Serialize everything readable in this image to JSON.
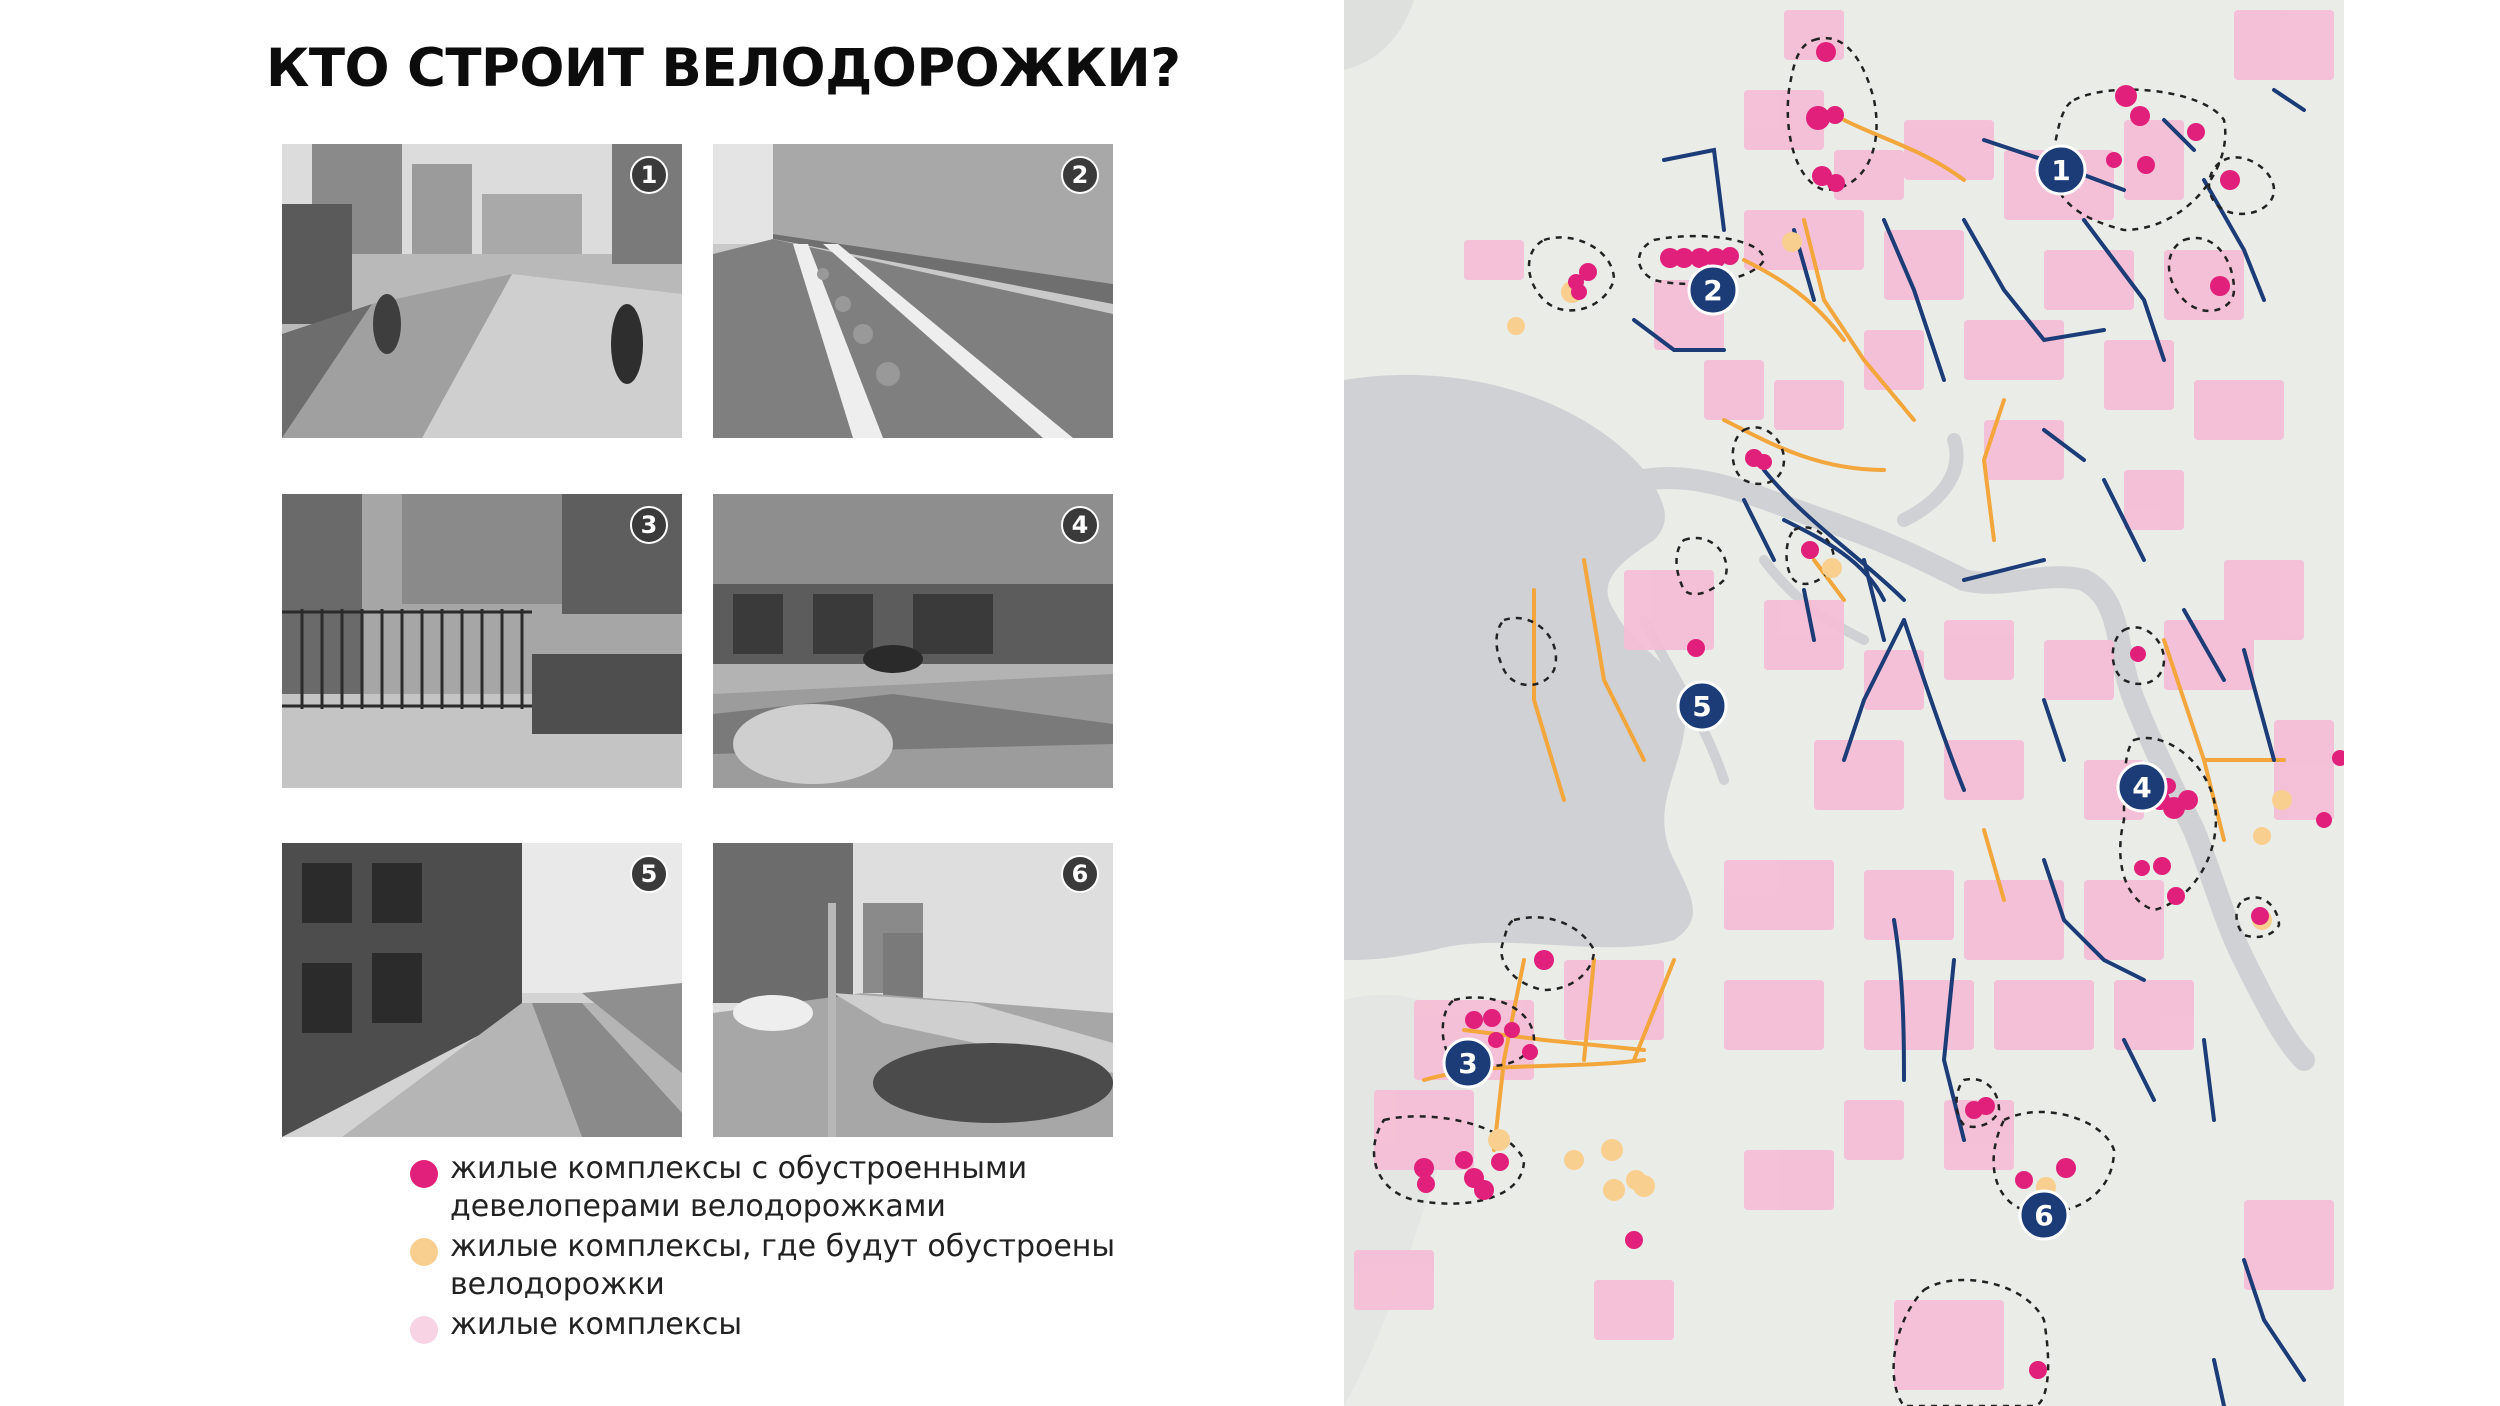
{
  "title": "КТО СТРОИТ ВЕЛОДОРОЖКИ?",
  "photos": [
    {
      "number": "1",
      "scene": "walkway"
    },
    {
      "number": "2",
      "scene": "bike-lane"
    },
    {
      "number": "3",
      "scene": "gate"
    },
    {
      "number": "4",
      "scene": "storefront-street"
    },
    {
      "number": "5",
      "scene": "embankment-path"
    },
    {
      "number": "6",
      "scene": "boulevard"
    }
  ],
  "legend": [
    {
      "text": "жилые комплексы с обустроенными девелоперами велодорожками",
      "color": "#e0207a"
    },
    {
      "text": "жилые комплексы, где будут обустроены велодорожки",
      "color": "#f9cf8f"
    },
    {
      "text": "жилые комплексы",
      "color": "#f7d3e4"
    }
  ],
  "map": {
    "badges": [
      "1",
      "2",
      "3",
      "4",
      "5",
      "6"
    ],
    "colors": {
      "background": "#eaece8",
      "water": "#cfd1d4",
      "residential": "#f6bcd6",
      "existing_lane": "#1c3c78",
      "planned_lane": "#f3a63b",
      "developer_dot": "#e0207a",
      "future_dot": "#f9cf8f"
    }
  }
}
